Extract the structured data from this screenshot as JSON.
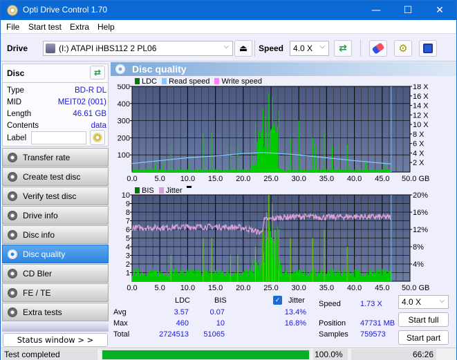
{
  "window": {
    "title": "Opti Drive Control 1.70",
    "controls": {
      "minimize": "—",
      "maximize": "☐",
      "close": "✕"
    }
  },
  "menu": [
    "File",
    "Start test",
    "Extra",
    "Help"
  ],
  "toolbar": {
    "drive_label": "Drive",
    "drive_value": "(I:)  ATAPI iHBS112   2 PL06",
    "speed_label": "Speed",
    "speed_value": "4.0 X",
    "icons": [
      "drive-icon",
      "eject-icon",
      "refresh-icon",
      "eraser-icon",
      "settings-icon",
      "save-icon"
    ]
  },
  "disc": {
    "header": "Disc",
    "fields": [
      {
        "key": "Type",
        "value": "BD-R DL"
      },
      {
        "key": "MID",
        "value": "MEIT02 (001)"
      },
      {
        "key": "Length",
        "value": "46.61 GB"
      },
      {
        "key": "Contents",
        "value": "data"
      }
    ],
    "label_key": "Label",
    "label_value": ""
  },
  "nav": [
    {
      "label": "Transfer rate",
      "active": false
    },
    {
      "label": "Create test disc",
      "active": false
    },
    {
      "label": "Verify test disc",
      "active": false
    },
    {
      "label": "Drive info",
      "active": false
    },
    {
      "label": "Disc info",
      "active": false
    },
    {
      "label": "Disc quality",
      "active": true
    },
    {
      "label": "CD Bler",
      "active": false
    },
    {
      "label": "FE / TE",
      "active": false
    },
    {
      "label": "Extra tests",
      "active": false
    }
  ],
  "status_window_label": "Status window > >",
  "main": {
    "title": "Disc quality",
    "colors": {
      "ldc": "#007a00",
      "read": "#80c8ff",
      "write": "#ff80ff",
      "bis": "#007a00",
      "jitter": "#d8a0d8",
      "bar": "#00cc00",
      "plotbg": "#5a6a90"
    }
  },
  "chart_data": [
    {
      "type": "bar",
      "title": "LDC / Read speed",
      "legend": [
        "LDC",
        "Read speed",
        "Write speed"
      ],
      "xlabel": "GB",
      "x_ticks": [
        "0.0",
        "5.0",
        "10.0",
        "15.0",
        "20.0",
        "25.0",
        "30.0",
        "35.0",
        "40.0",
        "45.0",
        "50.0 GB"
      ],
      "y_ticks_left": [
        "100",
        "200",
        "300",
        "400",
        "500"
      ],
      "y_ticks_right": [
        "2 X",
        "4 X",
        "6 X",
        "8 X",
        "10 X",
        "12 X",
        "14 X",
        "16 X",
        "18 X"
      ],
      "xlim": [
        0,
        50
      ],
      "ylim_left": [
        0,
        500
      ],
      "ylim_right": [
        0,
        18
      ],
      "end_marker_gb": 46.61,
      "ldc_peaks": [
        {
          "x": 0.3,
          "y": 40
        },
        {
          "x": 2.6,
          "y": 30
        },
        {
          "x": 4.2,
          "y": 50
        },
        {
          "x": 5.6,
          "y": 60
        },
        {
          "x": 7.0,
          "y": 150
        },
        {
          "x": 8.5,
          "y": 40
        },
        {
          "x": 10.2,
          "y": 50
        },
        {
          "x": 12.8,
          "y": 220
        },
        {
          "x": 14.3,
          "y": 225
        },
        {
          "x": 17.7,
          "y": 150
        },
        {
          "x": 19.0,
          "y": 150
        },
        {
          "x": 21.5,
          "y": 110
        },
        {
          "x": 22.2,
          "y": 290
        },
        {
          "x": 22.8,
          "y": 240
        },
        {
          "x": 23.6,
          "y": 370
        },
        {
          "x": 24.0,
          "y": 330
        },
        {
          "x": 24.6,
          "y": 460
        },
        {
          "x": 25.2,
          "y": 440
        },
        {
          "x": 25.7,
          "y": 240
        },
        {
          "x": 26.4,
          "y": 360
        },
        {
          "x": 28.5,
          "y": 200
        },
        {
          "x": 30.0,
          "y": 300
        },
        {
          "x": 32.5,
          "y": 200
        },
        {
          "x": 33.0,
          "y": 150
        },
        {
          "x": 34.6,
          "y": 240
        },
        {
          "x": 36.0,
          "y": 150
        },
        {
          "x": 38.7,
          "y": 160
        },
        {
          "x": 42.0,
          "y": 60
        },
        {
          "x": 45.5,
          "y": 50
        }
      ],
      "read_speed": [
        {
          "x": 0,
          "y": 1.8
        },
        {
          "x": 5,
          "y": 2.4
        },
        {
          "x": 10,
          "y": 3.0
        },
        {
          "x": 15,
          "y": 3.4
        },
        {
          "x": 20,
          "y": 3.9
        },
        {
          "x": 23.5,
          "y": 4.1
        },
        {
          "x": 25,
          "y": 4.0
        },
        {
          "x": 30,
          "y": 3.6
        },
        {
          "x": 35,
          "y": 3.0
        },
        {
          "x": 40,
          "y": 2.4
        },
        {
          "x": 46.6,
          "y": 1.7
        }
      ]
    },
    {
      "type": "bar",
      "title": "BIS / Jitter",
      "legend": [
        "BIS",
        "Jitter"
      ],
      "xlabel": "GB",
      "x_ticks": [
        "0.0",
        "5.0",
        "10.0",
        "15.0",
        "20.0",
        "25.0",
        "30.0",
        "35.0",
        "40.0",
        "45.0",
        "50.0 GB"
      ],
      "y_ticks_left": [
        "1",
        "2",
        "3",
        "4",
        "5",
        "6",
        "7",
        "8",
        "9",
        "10"
      ],
      "y_ticks_right": [
        "4%",
        "8%",
        "12%",
        "16%",
        "20%"
      ],
      "xlim": [
        0,
        50
      ],
      "ylim_left": [
        0,
        10
      ],
      "ylim_right": [
        0,
        20
      ],
      "end_marker_gb": 46.61,
      "bis_peaks": [
        {
          "x": 7.0,
          "y": 3
        },
        {
          "x": 12.8,
          "y": 5
        },
        {
          "x": 14.3,
          "y": 5
        },
        {
          "x": 17.7,
          "y": 3
        },
        {
          "x": 19.0,
          "y": 3
        },
        {
          "x": 22.2,
          "y": 4
        },
        {
          "x": 23.6,
          "y": 6
        },
        {
          "x": 24.2,
          "y": 8
        },
        {
          "x": 24.6,
          "y": 10
        },
        {
          "x": 25.2,
          "y": 9
        },
        {
          "x": 25.7,
          "y": 6
        },
        {
          "x": 26.4,
          "y": 6
        },
        {
          "x": 28.5,
          "y": 5
        },
        {
          "x": 32.5,
          "y": 5
        },
        {
          "x": 34.6,
          "y": 6
        },
        {
          "x": 38.7,
          "y": 4
        }
      ],
      "jitter": [
        {
          "x": 0,
          "y": 12.4
        },
        {
          "x": 5,
          "y": 12.4
        },
        {
          "x": 10,
          "y": 12.6
        },
        {
          "x": 15,
          "y": 12.6
        },
        {
          "x": 20,
          "y": 12.4
        },
        {
          "x": 23.3,
          "y": 11.2
        },
        {
          "x": 23.8,
          "y": 14.2
        },
        {
          "x": 27,
          "y": 14.8
        },
        {
          "x": 30,
          "y": 15.0
        },
        {
          "x": 35,
          "y": 14.8
        },
        {
          "x": 40,
          "y": 15.0
        },
        {
          "x": 46.6,
          "y": 14.8
        }
      ]
    }
  ],
  "stats": {
    "col_ldc": "LDC",
    "col_bis": "BIS",
    "col_jitter": "Jitter",
    "jitter_checked": true,
    "rows": [
      {
        "label": "Avg",
        "ldc": "3.57",
        "bis": "0.07",
        "jitter": "13.4%"
      },
      {
        "label": "Max",
        "ldc": "460",
        "bis": "10",
        "jitter": "16.8%"
      },
      {
        "label": "Total",
        "ldc": "2724513",
        "bis": "51065",
        "jitter": ""
      }
    ],
    "speed_label": "Speed",
    "speed_value": "1.73 X",
    "position_label": "Position",
    "position_value": "47731 MB",
    "samples_label": "Samples",
    "samples_value": "759573",
    "speed_select": "4.0 X",
    "start_full": "Start full",
    "start_part": "Start part"
  },
  "statusbar": {
    "text": "Test completed",
    "progress": 100.0,
    "progress_text": "100.0%",
    "time": "66:26"
  }
}
